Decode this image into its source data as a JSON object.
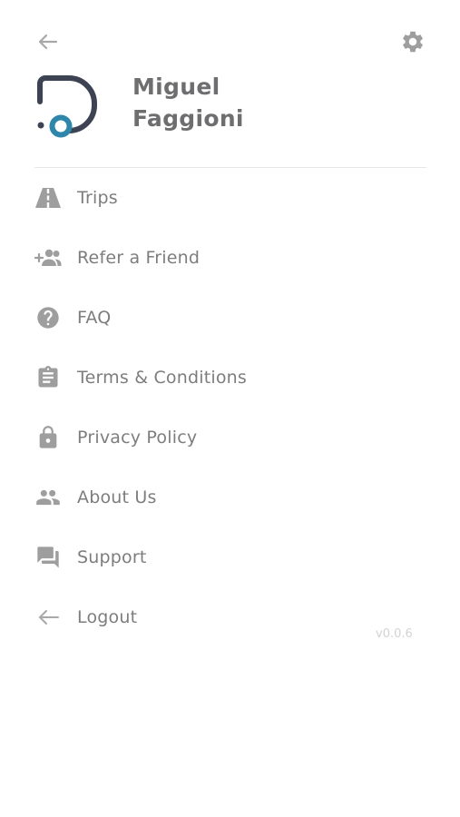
{
  "profile": {
    "first_name": "Miguel",
    "last_name": "Faggioni"
  },
  "menu": {
    "items": [
      {
        "label": "Trips",
        "icon": "road-icon"
      },
      {
        "label": "Refer a Friend",
        "icon": "add-people-icon"
      },
      {
        "label": "FAQ",
        "icon": "help-icon"
      },
      {
        "label": "Terms & Conditions",
        "icon": "clipboard-icon"
      },
      {
        "label": "Privacy Policy",
        "icon": "lock-icon"
      },
      {
        "label": "About Us",
        "icon": "people-icon"
      },
      {
        "label": "Support",
        "icon": "chat-icon"
      },
      {
        "label": "Logout",
        "icon": "arrow-left-icon"
      }
    ]
  },
  "version": "v0.0.6",
  "colors": {
    "icon": "#9e9e9e",
    "text": "#7d7d7f",
    "name": "#6e6e70",
    "logo_dark": "#3d4352",
    "logo_accent": "#2e86ab"
  }
}
